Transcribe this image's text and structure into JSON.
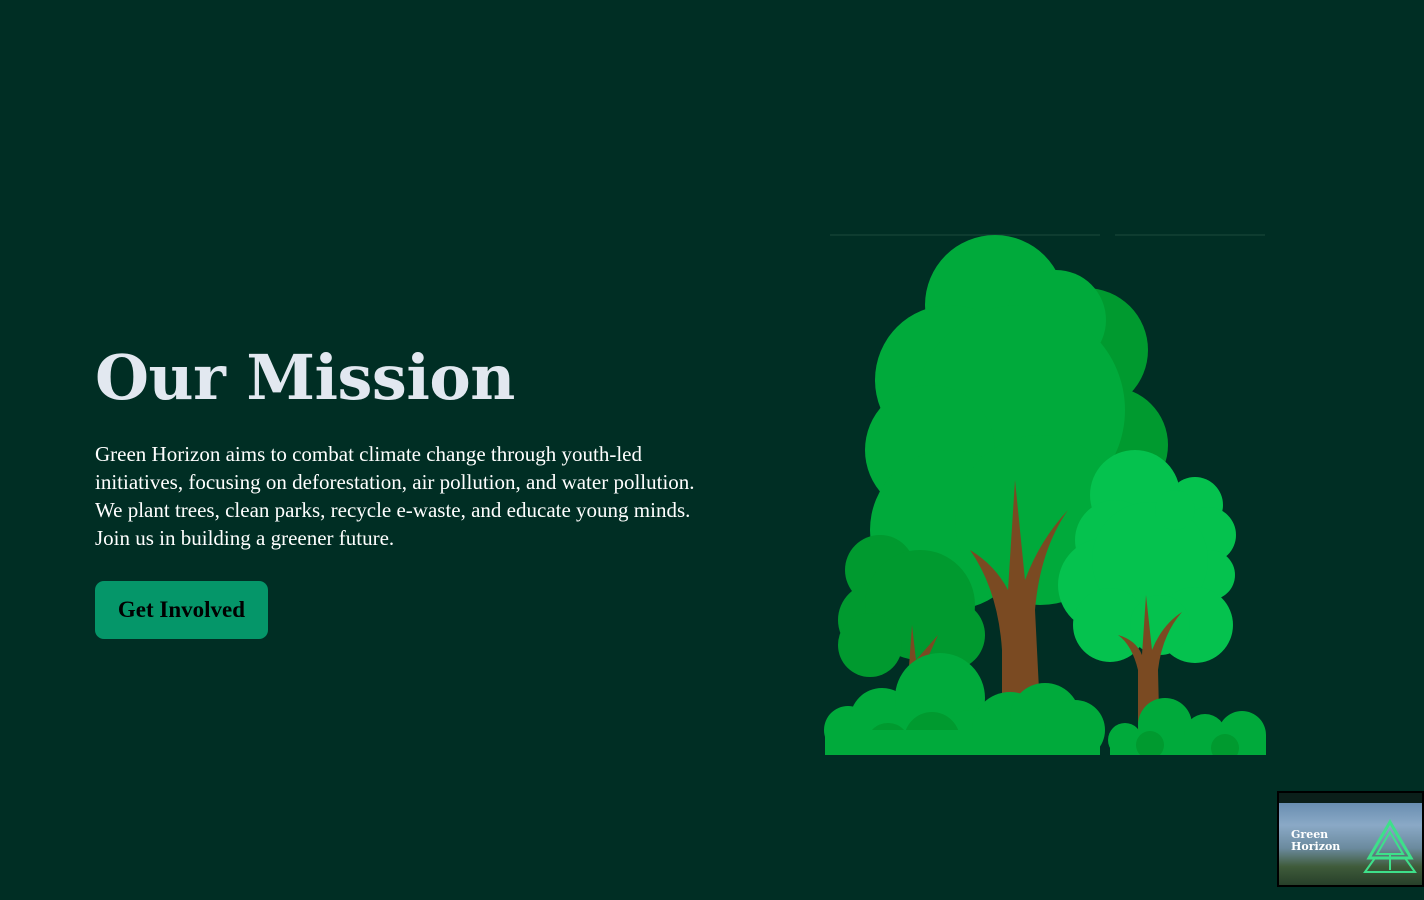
{
  "mission": {
    "title": "Our Mission",
    "text": "Green Horizon aims to combat climate change through youth-led initiatives, focusing on deforestation, air pollution, and water pollution. We plant trees, clean parks, recycle e-waste, and educate young minds. Join us in building a greener future.",
    "cta_label": "Get Involved"
  },
  "illustration": {
    "name": "trees-illustration"
  },
  "preview": {
    "title": "Green Horizon"
  },
  "colors": {
    "background": "#002e24",
    "accent": "#059669",
    "title": "#e2e8f0",
    "tree_dark": "#009a2f",
    "tree_mid": "#00aa3b",
    "tree_light": "#05c24e",
    "trunk": "#7a4a22"
  }
}
